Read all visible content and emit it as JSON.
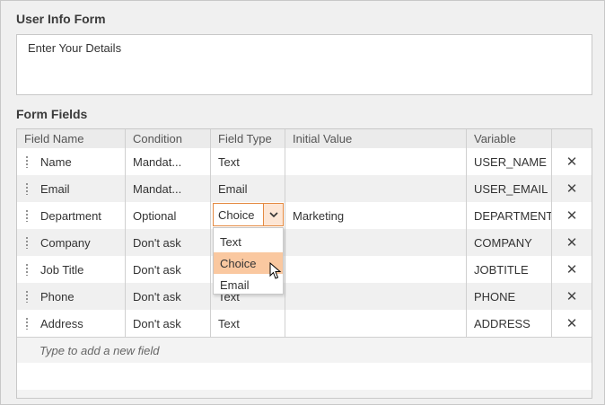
{
  "form": {
    "title": "User Info Form",
    "description": "Enter Your Details"
  },
  "fields_section": {
    "title": "Form Fields",
    "columns": {
      "name": "Field Name",
      "condition": "Condition",
      "type": "Field Type",
      "initial": "Initial Value",
      "variable": "Variable"
    },
    "rows": [
      {
        "name": "Name",
        "condition": "Mandat...",
        "type": "Text",
        "initial": "",
        "variable": "USER_NAME"
      },
      {
        "name": "Email",
        "condition": "Mandat...",
        "type": "Email",
        "initial": "",
        "variable": "USER_EMAIL"
      },
      {
        "name": "Department",
        "condition": "Optional",
        "type": "Choice",
        "initial": "Marketing",
        "variable": "DEPARTMENT"
      },
      {
        "name": "Company",
        "condition": "Don't ask",
        "type": "",
        "initial": "",
        "variable": "COMPANY"
      },
      {
        "name": "Job Title",
        "condition": "Don't ask",
        "type": "",
        "initial": "",
        "variable": "JOBTITLE"
      },
      {
        "name": "Phone",
        "condition": "Don't ask",
        "type": "Text",
        "initial": "",
        "variable": "PHONE"
      },
      {
        "name": "Address",
        "condition": "Don't ask",
        "type": "Text",
        "initial": "",
        "variable": "ADDRESS"
      }
    ],
    "delete_glyph": "✕",
    "add_placeholder": "Type to add a new field"
  },
  "editor": {
    "value": "Choice",
    "options": [
      "Text",
      "Choice",
      "Email"
    ],
    "selected_index": 1
  },
  "icons": {
    "drag": "drag-handle-icon",
    "delete": "close-icon",
    "dropdown": "chevron-down-icon",
    "pointer": "mouse-pointer-icon"
  },
  "colors": {
    "accent_border": "#e48a42",
    "selected_option": "#fac8a0"
  }
}
